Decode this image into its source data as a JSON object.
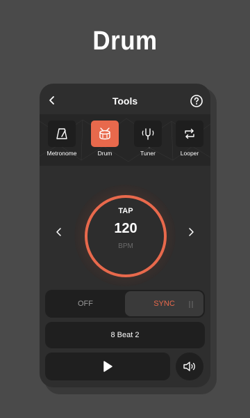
{
  "promo": {
    "title": "Drum"
  },
  "header": {
    "title": "Tools"
  },
  "tools": [
    {
      "label": "Metronome",
      "icon": "metronome-icon",
      "active": false
    },
    {
      "label": "Drum",
      "icon": "drum-icon",
      "active": true
    },
    {
      "label": "Tuner",
      "icon": "tuning-fork-icon",
      "active": false
    },
    {
      "label": "Looper",
      "icon": "loop-icon",
      "active": false
    }
  ],
  "dial": {
    "tap_label": "TAP",
    "bpm_value": "120",
    "bpm_unit": "BPM"
  },
  "toggle": {
    "off_label": "OFF",
    "sync_label": "SYNC",
    "selected": "SYNC"
  },
  "beat": {
    "label": "8 Beat 2"
  },
  "colors": {
    "accent": "#e8694c",
    "background": "#4a4a4a",
    "panel": "#2e2e2e",
    "button": "#1f1f1f"
  }
}
